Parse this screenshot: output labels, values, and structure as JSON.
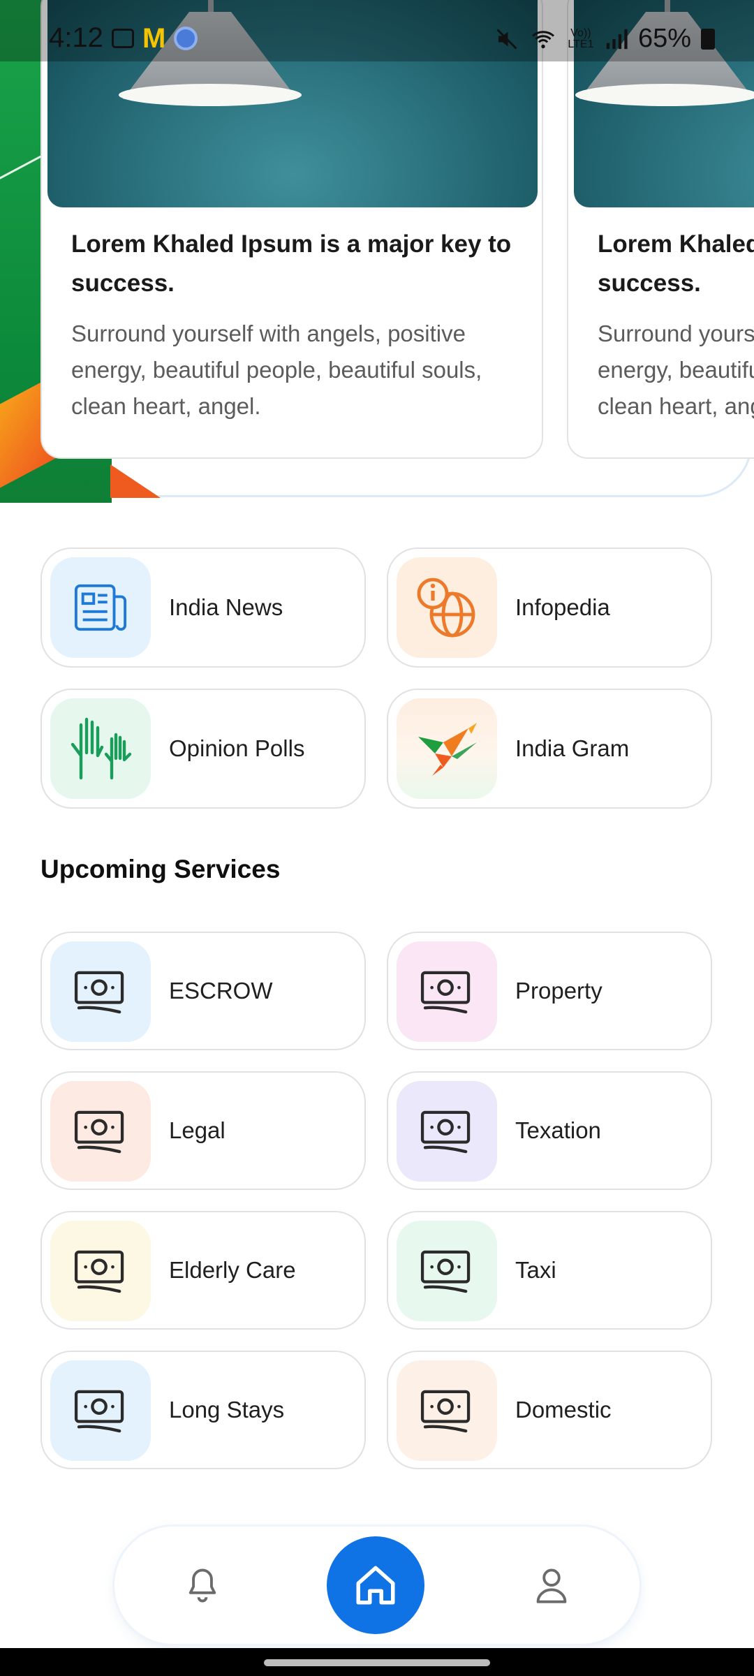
{
  "status_bar": {
    "time": "4:12",
    "battery": "65%",
    "network": "Vo)) LTE1"
  },
  "carousel": {
    "cards": [
      {
        "title": "Lorem Khaled Ipsum is a major key to success.",
        "body": "Surround yourself with angels, positive energy, beautiful people, beautiful souls, clean heart, angel."
      },
      {
        "title": "Lorem Khaled Ipsum is a major key to success.",
        "body": "Surround yourself with angels, positive energy, beautiful people, beautiful souls, clean heart, angel."
      }
    ]
  },
  "services": [
    {
      "label": "India News",
      "icon": "newspaper-icon",
      "bg": "#e3f2fd"
    },
    {
      "label": "Infopedia",
      "icon": "info-globe-icon",
      "bg": "#fdeee0"
    },
    {
      "label": "Opinion Polls",
      "icon": "raised-hands-icon",
      "bg": "#e6f8ee"
    },
    {
      "label": "India Gram",
      "icon": "bird-logo-icon",
      "bg": "#fdeee0"
    }
  ],
  "upcoming": {
    "title": "Upcoming Services",
    "items": [
      {
        "label": "ESCROW",
        "icon": "money-icon",
        "bg": "#e3f2fd"
      },
      {
        "label": "Property",
        "icon": "money-icon",
        "bg": "#fbe6f6"
      },
      {
        "label": "Legal",
        "icon": "money-icon",
        "bg": "#fdeae2"
      },
      {
        "label": "Texation",
        "icon": "money-icon",
        "bg": "#ece8fb"
      },
      {
        "label": "Elderly Care",
        "icon": "money-icon",
        "bg": "#fdf8e4"
      },
      {
        "label": "Taxi",
        "icon": "money-icon",
        "bg": "#e7f8ee"
      },
      {
        "label": "Long Stays",
        "icon": "money-icon",
        "bg": "#e3f2fd"
      },
      {
        "label": "Domestic",
        "icon": "money-icon",
        "bg": "#fdf0e6"
      }
    ]
  },
  "bottom_nav": {
    "items": [
      "bell-icon",
      "home-icon",
      "user-icon"
    ],
    "active": "home-icon",
    "accent": "#0f72e5"
  }
}
